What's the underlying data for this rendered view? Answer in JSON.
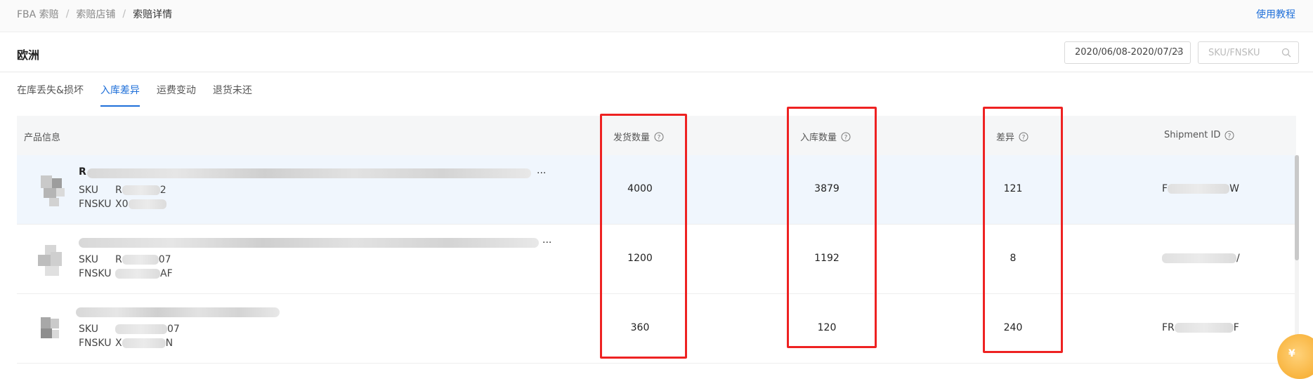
{
  "breadcrumb": {
    "item1": "FBA 索赔",
    "item2": "索赔店铺",
    "current": "索赔详情",
    "sep": "/"
  },
  "help_link": "使用教程",
  "page_title": "欧洲",
  "date_range": "2020/06/08-2020/07/23",
  "search": {
    "placeholder": "SKU/FNSKU",
    "value": ""
  },
  "tabs": [
    {
      "label": "在库丢失&损坏"
    },
    {
      "label": "入库差异",
      "active": true
    },
    {
      "label": "运费变动"
    },
    {
      "label": "退货未还"
    }
  ],
  "table": {
    "headers": {
      "product": "产品信息",
      "shipped": "发货数量",
      "received": "入库数量",
      "diff": "差异",
      "shipment_id": "Shipment ID"
    },
    "sku_label": "SKU",
    "fnsku_label": "FNSKU",
    "rows": [
      {
        "name_prefix": "R",
        "sku_prefix": "R",
        "sku_suffix": "2",
        "fnsku_prefix": "X0",
        "fnsku_suffix": "",
        "shipped": "4000",
        "received": "3879",
        "diff": "121",
        "shipment_prefix": "F",
        "shipment_suffix": "W"
      },
      {
        "name_prefix": "",
        "sku_prefix": "R",
        "sku_suffix": "07",
        "fnsku_prefix": "",
        "fnsku_suffix": "AF",
        "shipped": "1200",
        "received": "1192",
        "diff": "8",
        "shipment_prefix": "",
        "shipment_suffix": "/"
      },
      {
        "name_prefix": "",
        "sku_prefix": "",
        "sku_suffix": "07",
        "fnsku_prefix": "X",
        "fnsku_suffix": "N",
        "shipped": "360",
        "received": "120",
        "diff": "240",
        "shipment_prefix": "FR",
        "shipment_suffix": "F"
      }
    ]
  },
  "ellipsis": "...",
  "fab_label": "¥",
  "colors": {
    "accent": "#1e6fd9",
    "highlight_box": "#ee2222",
    "row_highlight": "#f0f6fd"
  }
}
